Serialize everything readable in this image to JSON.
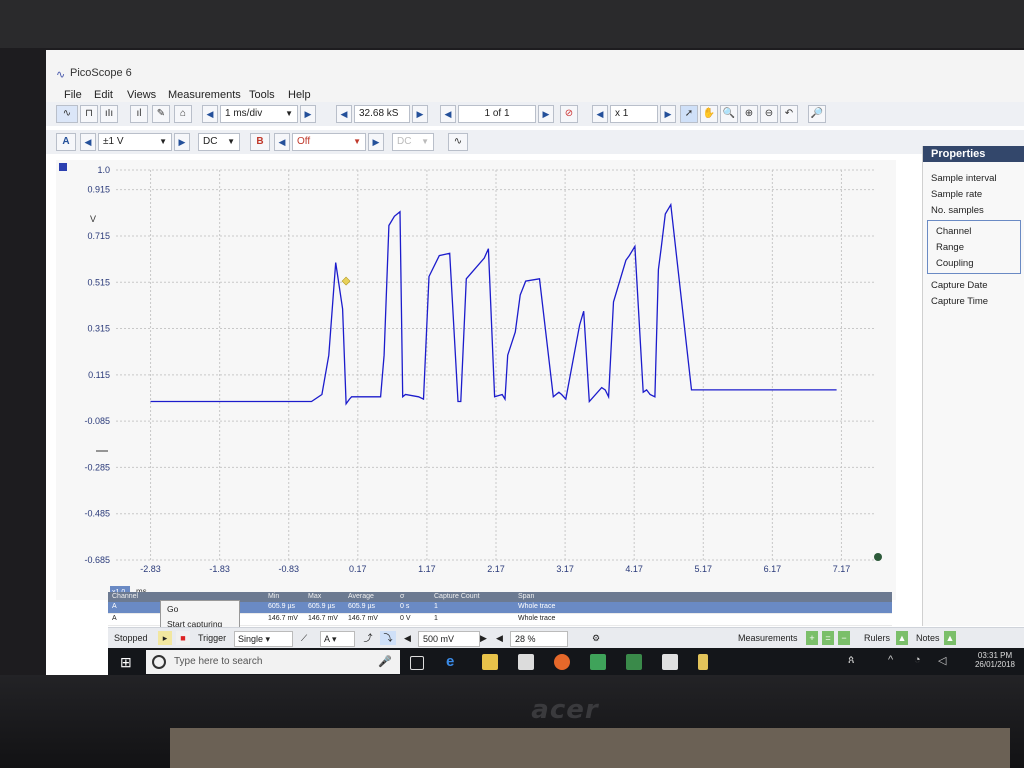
{
  "window": {
    "title": "PicoScope 6"
  },
  "menu": [
    "File",
    "Edit",
    "Views",
    "Measurements",
    "Tools",
    "Help"
  ],
  "toolbar1": {
    "timebase": "1 ms/div",
    "samples": "32.68 kS",
    "page": "1 of 1",
    "zoom": "x 1"
  },
  "toolbar2": {
    "channel_a_label": "A",
    "channel_a_range": "±1 V",
    "channel_a_coupling": "DC",
    "channel_b_label": "B",
    "channel_b_range": "Off",
    "channel_b_coupling": "DC"
  },
  "plot": {
    "unit_y": "V",
    "unit_x": "ms",
    "x_multiplier": "x1.0",
    "y_ticks": [
      "1.0",
      "0.915",
      "0.715",
      "0.515",
      "0.315",
      "0.115",
      "-0.085",
      "-0.285",
      "-0.485",
      "-0.685"
    ],
    "x_ticks": [
      "-2.83",
      "-1.83",
      "-0.83",
      "0.17",
      "1.17",
      "2.17",
      "3.17",
      "4.17",
      "5.17",
      "6.17",
      "7.17"
    ],
    "trace_color": "#1c1ccc"
  },
  "chart_data": {
    "type": "line",
    "xlabel": "ms",
    "ylabel": "V",
    "xlim": [
      -3.33,
      7.67
    ],
    "ylim": [
      -0.685,
      1.0
    ],
    "series": [
      {
        "x": [
          -2.83,
          -2.5,
          -2.0,
          -1.5,
          -1.0,
          -0.5,
          -0.35,
          -0.25,
          -0.15,
          -0.05,
          0.0,
          0.05,
          0.08,
          0.12,
          0.5,
          0.55,
          0.62,
          0.7,
          0.78,
          0.82,
          0.86,
          1.05,
          1.12,
          1.2,
          1.35,
          1.5,
          1.62,
          1.66,
          1.74,
          2.0,
          2.06,
          2.15,
          2.26,
          2.3,
          2.34,
          2.45,
          2.52,
          2.6,
          2.8,
          3.0,
          3.08,
          3.12,
          3.18,
          3.38,
          3.44,
          3.52,
          3.7,
          3.75,
          3.8,
          3.87,
          4.05,
          4.1,
          4.18,
          4.3,
          4.35,
          4.4,
          4.47,
          4.52,
          4.56,
          4.62,
          4.7,
          5.0,
          5.5,
          6.0,
          6.5,
          7.0,
          7.1
        ],
        "y": [
          0.0,
          0.0,
          0.0,
          0.0,
          0.0,
          0.0,
          0.03,
          0.2,
          0.6,
          0.4,
          -0.01,
          0.01,
          0.02,
          0.02,
          0.02,
          0.2,
          0.76,
          0.8,
          0.82,
          0.02,
          0.03,
          0.02,
          0.01,
          0.54,
          0.63,
          0.64,
          0.0,
          0.0,
          0.53,
          0.62,
          0.66,
          0.02,
          0.03,
          0.01,
          0.2,
          0.3,
          0.46,
          0.52,
          0.53,
          0.02,
          0.04,
          0.03,
          0.01,
          0.33,
          0.39,
          0.0,
          0.06,
          0.05,
          0.02,
          0.43,
          0.61,
          0.63,
          0.67,
          0.04,
          0.05,
          0.03,
          0.02,
          0.57,
          0.66,
          0.81,
          0.85,
          0.05,
          0.05,
          0.05,
          0.05,
          0.05,
          0.05
        ]
      }
    ]
  },
  "properties": {
    "header": "Properties",
    "items_top": [
      "Sample interval",
      "Sample rate",
      "No. samples"
    ],
    "items_box": [
      "Channel",
      "Range",
      "Coupling"
    ],
    "items_bottom": [
      "Capture Date",
      "Capture Time"
    ]
  },
  "measure_table": {
    "headers": [
      "Channel",
      "Min",
      "Max",
      "Average",
      "σ",
      "Capture Count",
      "Span"
    ],
    "rows": [
      [
        "A",
        "605.9 µs",
        "605.9 µs",
        "605.9 µs",
        "0 s",
        "1",
        "Whole trace"
      ],
      [
        "A",
        "146.7 mV",
        "146.7 mV",
        "146.7 mV",
        "0 V",
        "1",
        "Whole trace"
      ]
    ]
  },
  "popup": {
    "go": "Go",
    "start": "Start capturing"
  },
  "statusbar": {
    "state": "Stopped",
    "trigger_label": "Trigger",
    "trigger_mode": "Single",
    "trigger_channel": "A",
    "threshold": "500 mV",
    "pre_trigger": "28 %",
    "measurements": "Measurements",
    "rulers": "Rulers",
    "notes": "Notes"
  },
  "taskbar": {
    "search_placeholder": "Type here to search",
    "time": "03:31 PM",
    "date": "26/01/2018"
  },
  "laptop": {
    "brand": "acer"
  }
}
